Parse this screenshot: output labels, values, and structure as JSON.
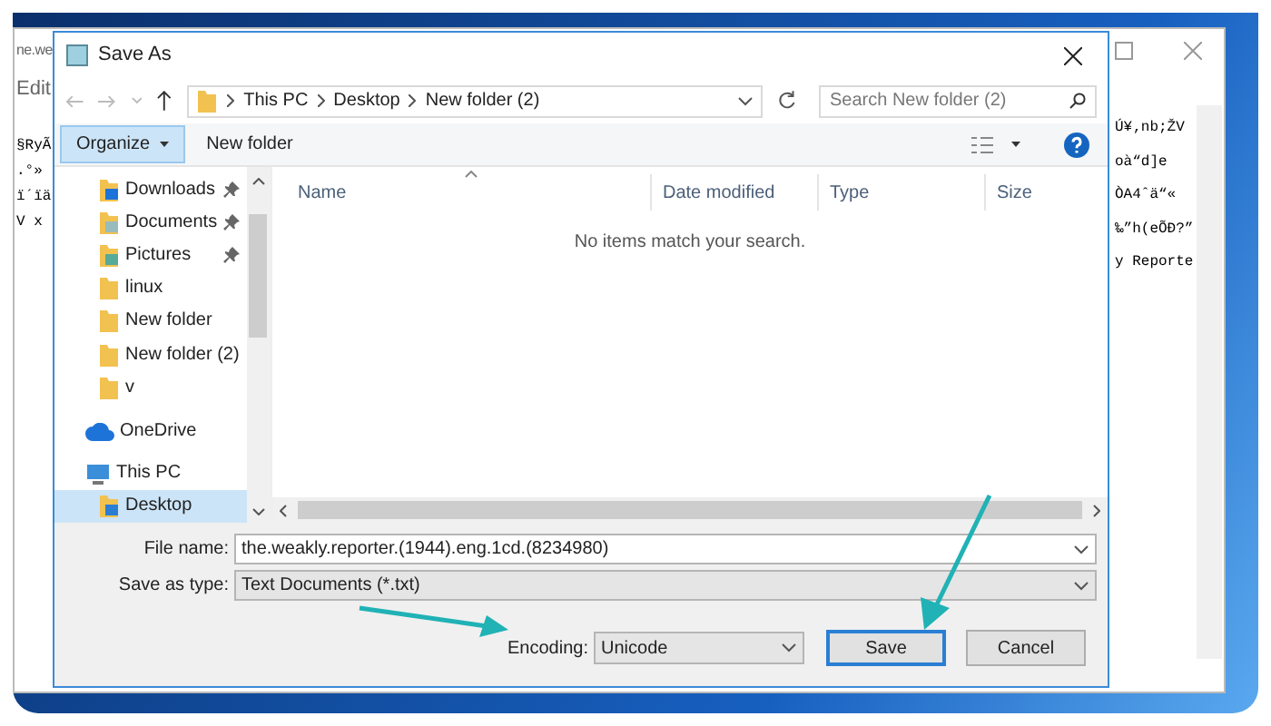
{
  "notepad": {
    "title": "ne.we",
    "menu": [
      "Edit"
    ],
    "left_text": [
      "§RyÃ",
      ".°»",
      "ï´ïä",
      "V x"
    ],
    "right_text": [
      "Ú¥‚nb;ŽV",
      "oà“d]e",
      "ÒA4ˆä“«",
      "‰”h(eÕÐ?”",
      "y Reporte"
    ]
  },
  "dialog": {
    "title": "Save As",
    "breadcrumb": [
      "This PC",
      "Desktop",
      "New folder (2)"
    ],
    "search": {
      "placeholder": "Search New folder (2)"
    },
    "toolbar": {
      "organize": "Organize",
      "new_folder": "New folder"
    },
    "nav": [
      {
        "label": "Downloads",
        "kind": "downloads",
        "pinned": true,
        "selected": false
      },
      {
        "label": "Documents",
        "kind": "documents",
        "pinned": true,
        "selected": false
      },
      {
        "label": "Pictures",
        "kind": "pictures",
        "pinned": true,
        "selected": false
      },
      {
        "label": "linux",
        "kind": "folder",
        "pinned": false,
        "selected": false
      },
      {
        "label": "New folder",
        "kind": "folder",
        "pinned": false,
        "selected": false
      },
      {
        "label": "New folder (2)",
        "kind": "folder",
        "pinned": false,
        "selected": false
      },
      {
        "label": "v",
        "kind": "folder",
        "pinned": false,
        "selected": false
      },
      {
        "label": "OneDrive",
        "kind": "cloud",
        "pinned": false,
        "selected": false
      },
      {
        "label": "This PC",
        "kind": "pc",
        "pinned": false,
        "selected": false,
        "children": [
          {
            "label": "Desktop",
            "kind": "desktop",
            "pinned": false,
            "selected": true
          }
        ]
      }
    ],
    "columns": [
      "Name",
      "Date modified",
      "Type",
      "Size"
    ],
    "empty_message": "No items match your search.",
    "file_name": {
      "label": "File name:",
      "value": "the.weakly.reporter.(1944).eng.1cd.(8234980)"
    },
    "save_as_type": {
      "label": "Save as type:",
      "value": "Text Documents (*.txt)"
    },
    "encoding": {
      "label": "Encoding:",
      "value": "Unicode"
    },
    "buttons": [
      {
        "label": "Save",
        "kind": "default"
      },
      {
        "label": "Cancel",
        "kind": "normal"
      }
    ]
  }
}
